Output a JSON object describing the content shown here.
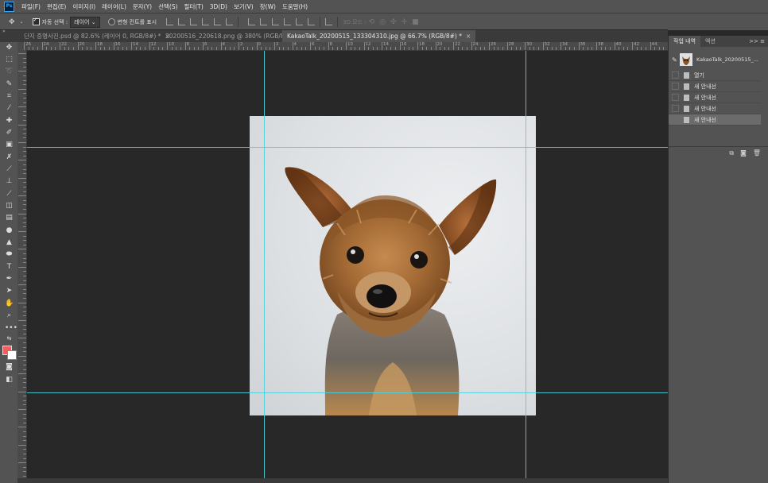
{
  "menubar": {
    "logo": "Ps",
    "items": [
      "파일(F)",
      "편집(E)",
      "이미지(I)",
      "레이어(L)",
      "문자(Y)",
      "선택(S)",
      "필터(T)",
      "3D(D)",
      "보기(V)",
      "창(W)",
      "도움말(H)"
    ]
  },
  "options": {
    "auto_select_label": "자동 선택 :",
    "auto_select_value": "레이어",
    "transform_label": "변형 컨트롤 표시",
    "mode_3d_label": "3D 모드 :"
  },
  "tabs": [
    {
      "label": "단지 증명사진.psd @ 82.6% (레이어 0, RGB/8#) *",
      "active": false
    },
    {
      "label": "20200516_220618.png @ 380% (RGB/8)",
      "active": false
    },
    {
      "label": "KakaoTalk_20200515_133304310.jpg @ 66.7% (RGB/8#) *",
      "active": true
    }
  ],
  "ruler_labels": [
    "26",
    "24",
    "22",
    "20",
    "18",
    "16",
    "14",
    "12",
    "10",
    "8",
    "6",
    "4",
    "2",
    "0",
    "2",
    "4",
    "6",
    "8",
    "10",
    "12",
    "14",
    "16",
    "18",
    "20",
    "22",
    "24",
    "26",
    "28",
    "30",
    "32",
    "34",
    "36",
    "38",
    "40",
    "42",
    "44",
    "46"
  ],
  "history_panel": {
    "tabs": [
      "작업 내역",
      "액션"
    ],
    "menu_glyph": ">> ≡",
    "snapshot_label": "KakaoTalk_20200515_...",
    "steps": [
      {
        "label": "열기",
        "selected": false
      },
      {
        "label": "새 안내선",
        "selected": false
      },
      {
        "label": "새 안내선",
        "selected": false
      },
      {
        "label": "새 안내선",
        "selected": false
      },
      {
        "label": "새 안내선",
        "selected": true
      }
    ]
  },
  "colors": {
    "guide": "#4bd0dc",
    "foreground": "#f06060",
    "background": "#ffffff"
  }
}
